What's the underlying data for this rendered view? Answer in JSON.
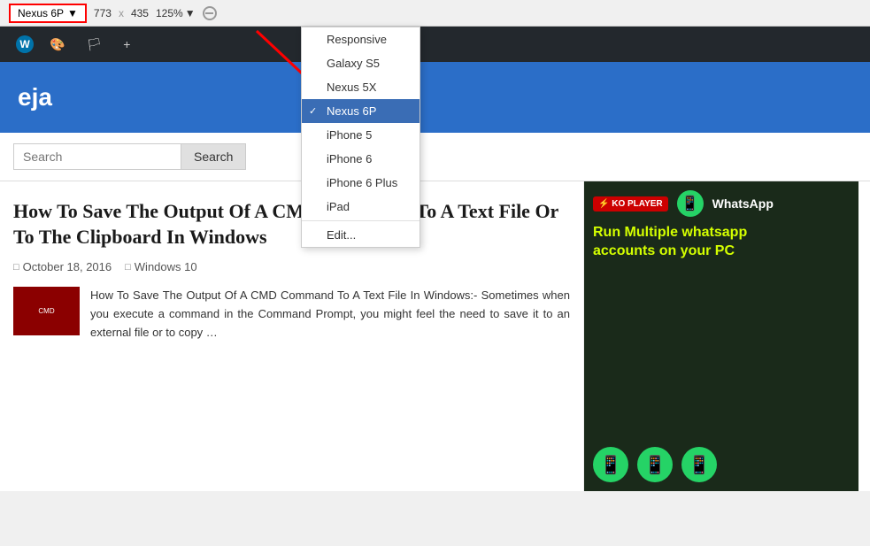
{
  "toolbar": {
    "device_label": "Nexus 6P",
    "dropdown_arrow": "▼",
    "width": "773",
    "cross": "x",
    "height": "435",
    "zoom": "125%",
    "zoom_arrow": "▼"
  },
  "dropdown": {
    "items": [
      {
        "id": "responsive",
        "label": "Responsive",
        "selected": false
      },
      {
        "id": "galaxy-s5",
        "label": "Galaxy S5",
        "selected": false
      },
      {
        "id": "nexus-5x",
        "label": "Nexus 5X",
        "selected": false
      },
      {
        "id": "nexus-6p",
        "label": "Nexus 6P",
        "selected": true
      },
      {
        "id": "iphone-5",
        "label": "iPhone 5",
        "selected": false
      },
      {
        "id": "iphone-6",
        "label": "iPhone 6",
        "selected": false
      },
      {
        "id": "iphone-6-plus",
        "label": "iPhone 6 Plus",
        "selected": false
      },
      {
        "id": "ipad",
        "label": "iPad",
        "selected": false
      },
      {
        "id": "edit",
        "label": "Edit...",
        "selected": false
      }
    ]
  },
  "admin_bar": {
    "items": [
      "W",
      "🎨",
      "🏳",
      "+"
    ]
  },
  "site": {
    "title": "eja"
  },
  "search": {
    "placeholder": "Search",
    "button_label": "Search"
  },
  "article": {
    "title": "How To Save The Output Of A CMD Command To A Text File Or To The Clipboard In Windows",
    "date": "October 18, 2016",
    "category": "Windows 10",
    "excerpt": "How To Save The Output Of A CMD Command To A Text File In Windows:- Sometimes when you execute a command in the Command Prompt, you might feel the need to save it to an external file or to copy …"
  },
  "ad": {
    "brand1": "KO PLAYER",
    "brand2": "WhatsApp",
    "text_line1": "Run Multiple whatsapp",
    "text_line2": "accounts on your PC"
  }
}
